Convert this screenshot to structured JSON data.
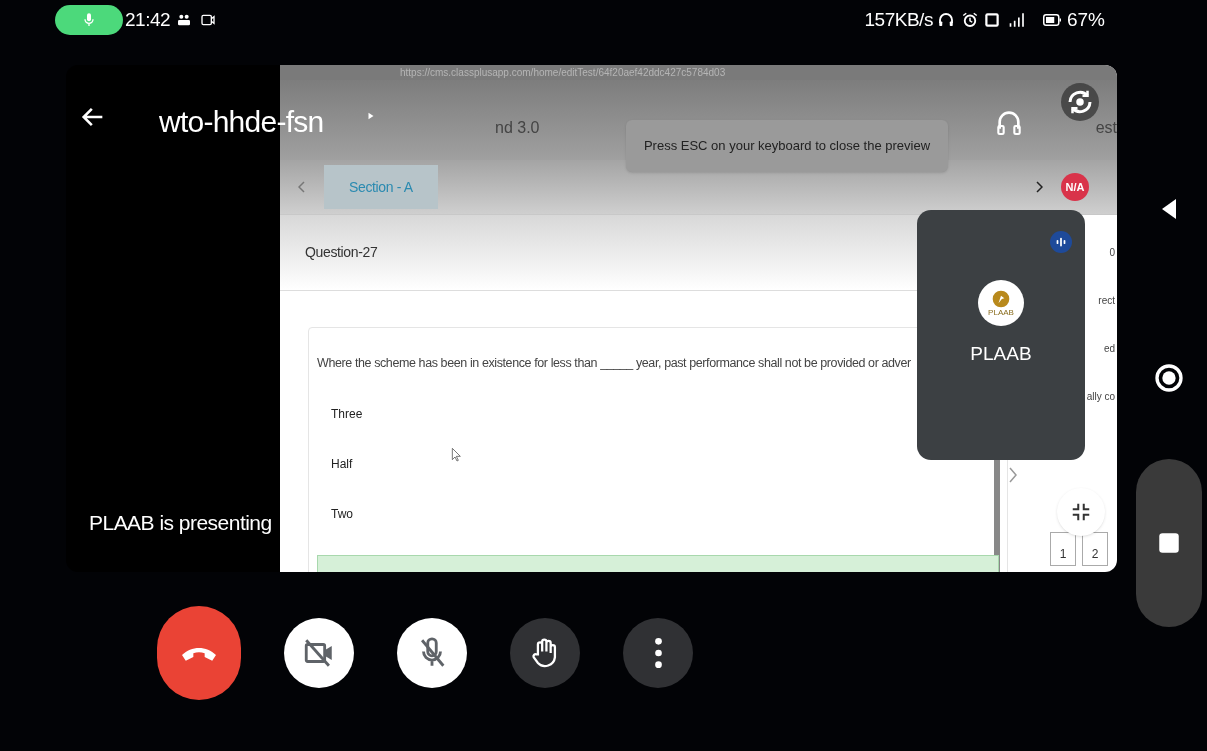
{
  "status_bar": {
    "time": "21:42",
    "speed": "157KB/s",
    "battery": "67%"
  },
  "meeting": {
    "title": "wto-hhde-fsn",
    "presenting": "PLAAB is presenting"
  },
  "shared_screen": {
    "url": "https://cms.classplusapp.com/home/editTest/64f20aef42ddc427c5784d03",
    "page_title": "nd 3.0",
    "corner_text": "est",
    "toast": "Press ESC on your keyboard to close the preview",
    "sections": [
      {
        "label": "Section - A",
        "selected": true
      }
    ],
    "badge": "N/A",
    "question_label": "Question-27",
    "question": "Where the scheme has been in existence for less than _____ year, past performance shall not be provided or adver",
    "options": [
      {
        "label": "Three",
        "selected": false
      },
      {
        "label": "Half",
        "selected": false
      },
      {
        "label": "Two",
        "selected": false
      },
      {
        "selected": true
      }
    ],
    "side_texts": [
      "0",
      "rect",
      "ed",
      "ally co"
    ],
    "palette_numbers": [
      "1",
      "2"
    ]
  },
  "participant": {
    "name": "PLAAB",
    "logo_text": "PLAAB",
    "speaking": true
  },
  "controls": [
    {
      "kind": "end_call"
    },
    {
      "kind": "camera",
      "on": false
    },
    {
      "kind": "mic",
      "on": false
    },
    {
      "kind": "hand"
    },
    {
      "kind": "more"
    }
  ]
}
